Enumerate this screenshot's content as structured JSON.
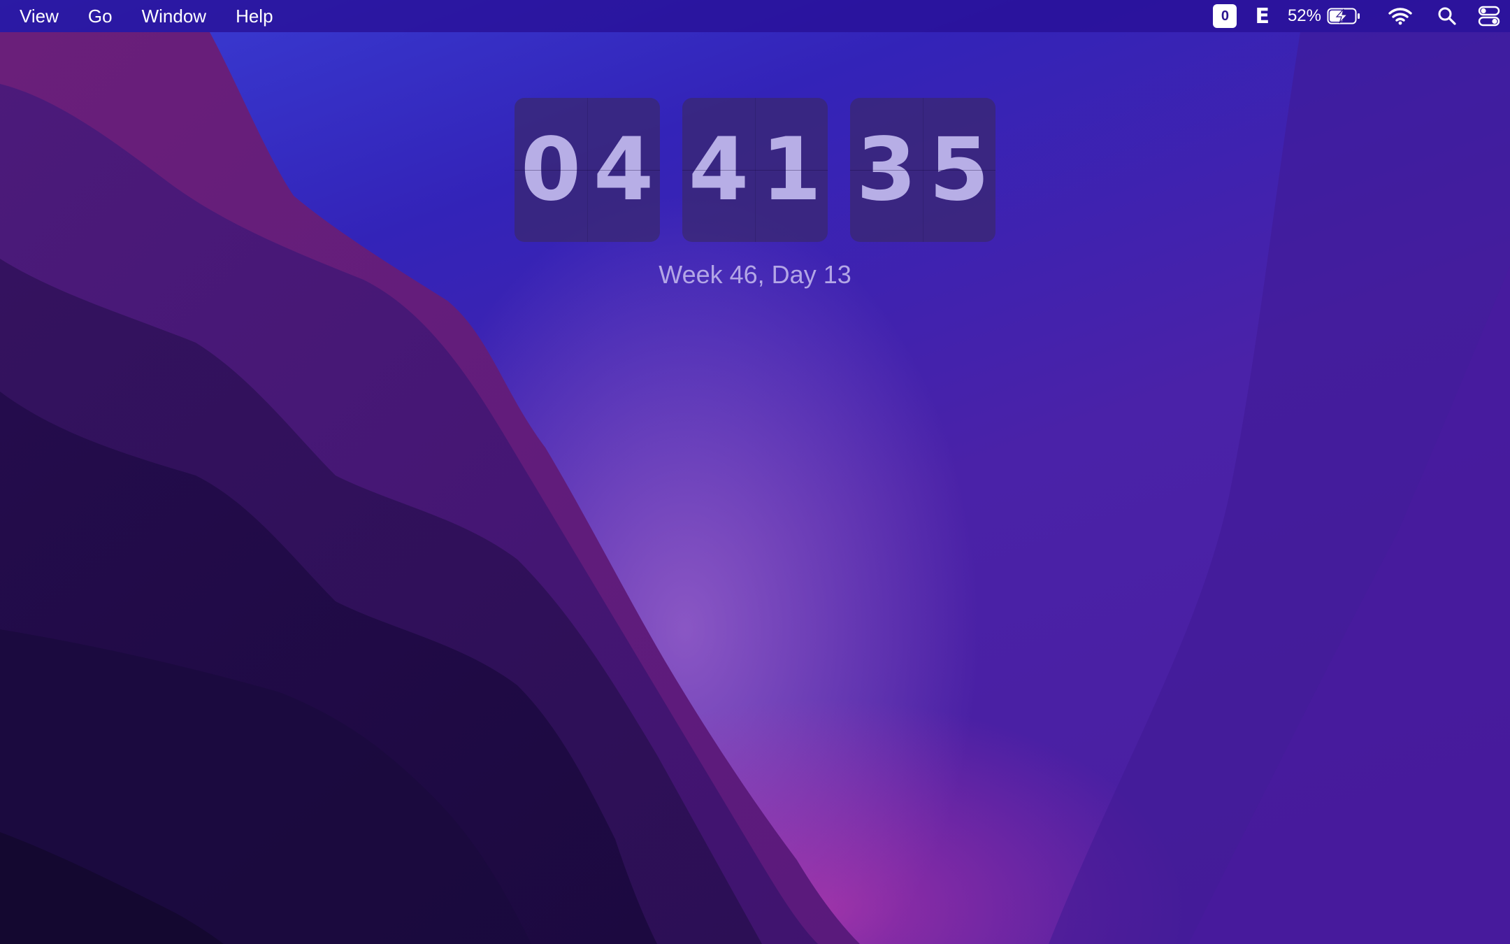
{
  "menubar": {
    "menus": [
      "View",
      "Go",
      "Window",
      "Help"
    ],
    "status": {
      "app_badge": "0",
      "e_glyph": "E",
      "battery_percent": "52%",
      "icons": [
        "app-badge-icon",
        "e-icon",
        "battery-charging-icon",
        "wifi-icon",
        "search-icon",
        "control-center-icon"
      ]
    }
  },
  "clock": {
    "hours": [
      "0",
      "4"
    ],
    "minutes": [
      "4",
      "1"
    ],
    "seconds": [
      "3",
      "5"
    ]
  },
  "week_label": "Week 46, Day 13"
}
